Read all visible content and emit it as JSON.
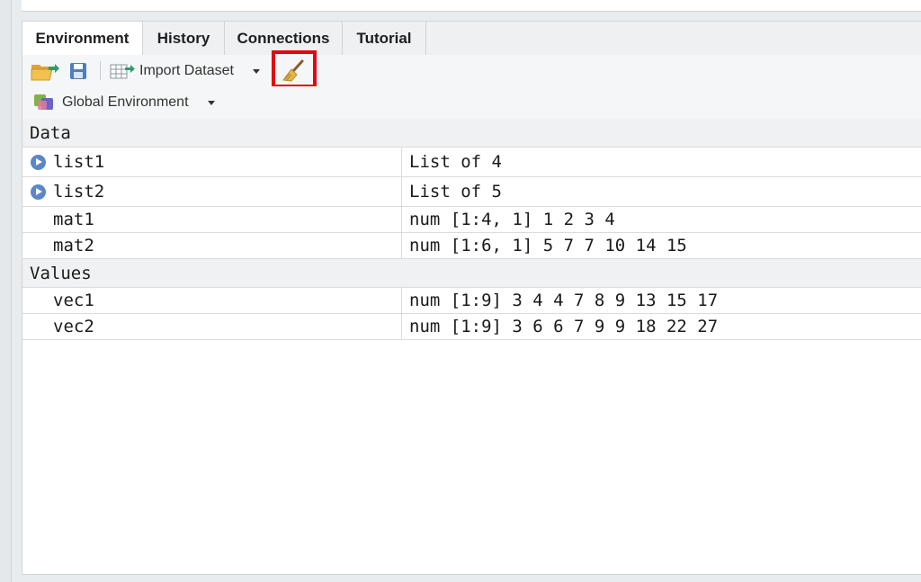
{
  "tabs": [
    {
      "label": "Environment",
      "active": true
    },
    {
      "label": "History",
      "active": false
    },
    {
      "label": "Connections",
      "active": false
    },
    {
      "label": "Tutorial",
      "active": false
    }
  ],
  "toolbar": {
    "load_icon": "folder-open-icon",
    "save_icon": "save-icon",
    "import_icon": "import-dataset-icon",
    "import_label": "Import Dataset",
    "clear_icon": "broom-icon",
    "highlight_color": "#e30613"
  },
  "env_selector": {
    "icon": "r-environment-icon",
    "label": "Global Environment"
  },
  "sections": {
    "data": {
      "label": "Data",
      "rows": [
        {
          "name": "list1",
          "value": "List of 4",
          "expandable": true
        },
        {
          "name": "list2",
          "value": "List of 5",
          "expandable": true
        },
        {
          "name": "mat1",
          "value": "num [1:4, 1] 1 2 3 4",
          "expandable": false
        },
        {
          "name": "mat2",
          "value": "num [1:6, 1] 5 7 7 10 14 15",
          "expandable": false
        }
      ]
    },
    "values": {
      "label": "Values",
      "rows": [
        {
          "name": "vec1",
          "value": "num [1:9] 3 4 4 7 8 9 13 15 17"
        },
        {
          "name": "vec2",
          "value": "num [1:9] 3 6 6 7 9 9 18 22 27"
        }
      ]
    }
  }
}
